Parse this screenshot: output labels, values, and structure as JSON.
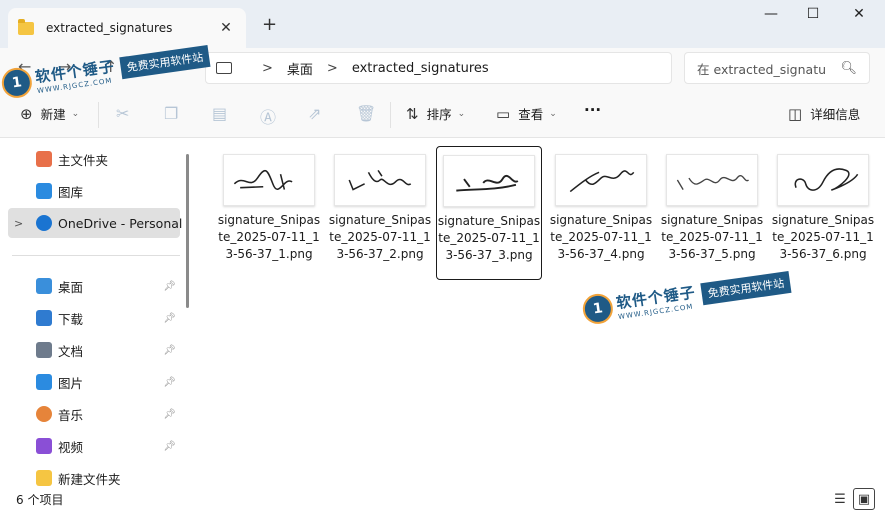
{
  "window": {
    "tab_title": "extracted_signatures",
    "tab_close": "✕",
    "new_tab": "+",
    "minimize": "—",
    "maximize": "☐",
    "close": "✕"
  },
  "address": {
    "back": "←",
    "forward": "→",
    "up": "↑",
    "refresh": "↻",
    "separators": [
      ">",
      ">"
    ],
    "crumbs": [
      "桌面",
      "extracted_signatures"
    ]
  },
  "search": {
    "placeholder": "在 extracted_signatu"
  },
  "toolbar": {
    "new_label": "新建",
    "sort_label": "排序",
    "view_label": "查看",
    "more_label": "···",
    "details_label": "详细信息",
    "icons": [
      "add-icon",
      "cut-icon",
      "copy-icon",
      "paste-icon",
      "rename-icon",
      "share-icon",
      "delete-icon",
      "sort-icon",
      "view-icon",
      "details-pane-icon"
    ]
  },
  "sidebar": {
    "top_items": [
      {
        "label": "主文件夹",
        "color": "#e8704a"
      },
      {
        "label": "图库",
        "color": "#2b8be0"
      },
      {
        "label": "OneDrive - Personal",
        "color": "#1a74d1",
        "selected": true,
        "chevron": ">"
      }
    ],
    "pinned_items": [
      {
        "label": "桌面",
        "color": "#3a8fdb"
      },
      {
        "label": "下载",
        "color": "#2f7bd0"
      },
      {
        "label": "文档",
        "color": "#6e7b8c"
      },
      {
        "label": "图片",
        "color": "#2b8be0"
      },
      {
        "label": "音乐",
        "color": "#e6843a"
      },
      {
        "label": "视频",
        "color": "#8a4fd6"
      },
      {
        "label": "新建文件夹",
        "color": "#f5c542"
      }
    ],
    "pin_glyph": "📌"
  },
  "files": [
    {
      "name": "signature_Snipaste_2025-07-11_13-56-37_1.png",
      "selected": false
    },
    {
      "name": "signature_Snipaste_2025-07-11_13-56-37_2.png",
      "selected": false
    },
    {
      "name": "signature_Snipaste_2025-07-11_13-56-37_3.png",
      "selected": true
    },
    {
      "name": "signature_Snipaste_2025-07-11_13-56-37_4.png",
      "selected": false
    },
    {
      "name": "signature_Snipaste_2025-07-11_13-56-37_5.png",
      "selected": false
    },
    {
      "name": "signature_Snipaste_2025-07-11_13-56-37_6.png",
      "selected": false
    }
  ],
  "status": {
    "count": "6 个项目",
    "list_view": "☰",
    "grid_view": "▣"
  },
  "watermark": {
    "logo": "1",
    "title": "软件个锤子",
    "domain": "WWW.RJGCZ.COM",
    "slogan": "免费实用软件站"
  }
}
